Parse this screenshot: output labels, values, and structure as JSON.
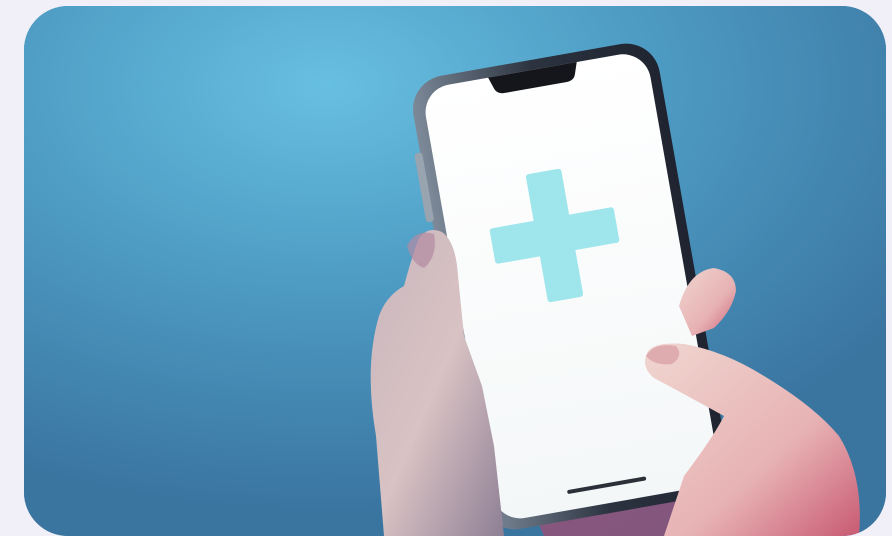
{
  "image": {
    "subject": "hand-holding-smartphone-with-plus-symbol",
    "colors": {
      "page_background": "#f1f0f8",
      "sky_blue": "#5aa9d0",
      "screen_white": "#fbfdfd",
      "cross_cyan": "#9fe6ec",
      "skin_light": "#e8c9c4",
      "skin_pink": "#e0607a",
      "phone_frame": "#2d3340"
    },
    "icons": [
      "plus-icon"
    ]
  }
}
